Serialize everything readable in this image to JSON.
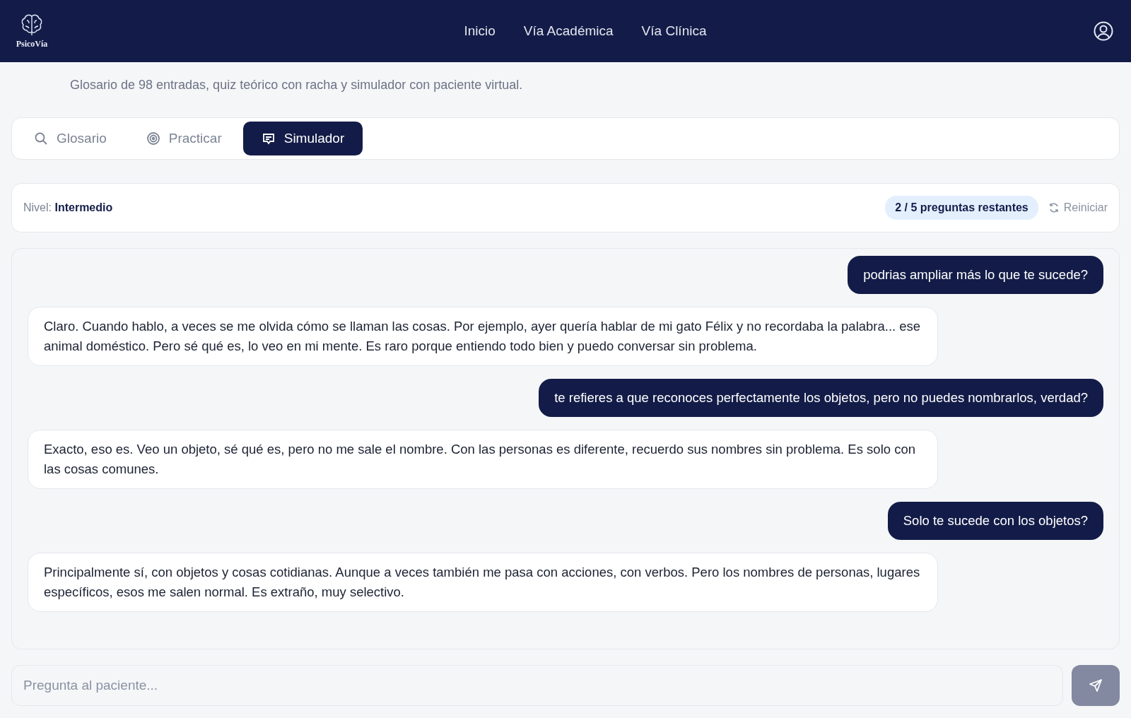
{
  "header": {
    "logo_text": "PsicoVía",
    "nav": [
      {
        "label": "Inicio"
      },
      {
        "label": "Vía Académica"
      },
      {
        "label": "Vía Clínica"
      }
    ]
  },
  "subtitle": "Glosario de 98 entradas, quiz teórico con racha y simulador con paciente virtual.",
  "tabs": [
    {
      "label": "Glosario",
      "kind": "search",
      "selected": false
    },
    {
      "label": "Practicar",
      "kind": "target",
      "selected": false
    },
    {
      "label": "Simulador",
      "kind": "chat",
      "selected": true
    }
  ],
  "session": {
    "level_label": "Nivel:",
    "level_value": "Intermedio",
    "remaining": "2 / 5 preguntas restantes",
    "reset": "Reiniciar"
  },
  "messages": [
    {
      "kind": "user",
      "text": "podrias ampliar más lo que te sucede?"
    },
    {
      "kind": "patient",
      "text": "Claro. Cuando hablo, a veces se me olvida cómo se llaman las cosas. Por ejemplo, ayer quería hablar de mi gato Félix y no recordaba la palabra... ese animal doméstico. Pero sé qué es, lo veo en mi mente. Es raro porque entiendo todo bien y puedo conversar sin problema."
    },
    {
      "kind": "user",
      "text": "te refieres a que reconoces perfectamente los objetos, pero no puedes nombrarlos, verdad?"
    },
    {
      "kind": "patient",
      "text": "Exacto, eso es. Veo un objeto, sé qué es, pero no me sale el nombre. Con las personas es diferente, recuerdo sus nombres sin problema. Es solo con las cosas comunes."
    },
    {
      "kind": "user",
      "text": "Solo te sucede con los objetos?"
    },
    {
      "kind": "patient",
      "text": "Principalmente sí, con objetos y cosas cotidianas. Aunque a veces también me pasa con acciones, con verbos. Pero los nombres de personas, lugares específicos, esos me salen normal. Es extraño, muy selectivo."
    }
  ],
  "composer": {
    "placeholder": "Pregunta al paciente..."
  }
}
